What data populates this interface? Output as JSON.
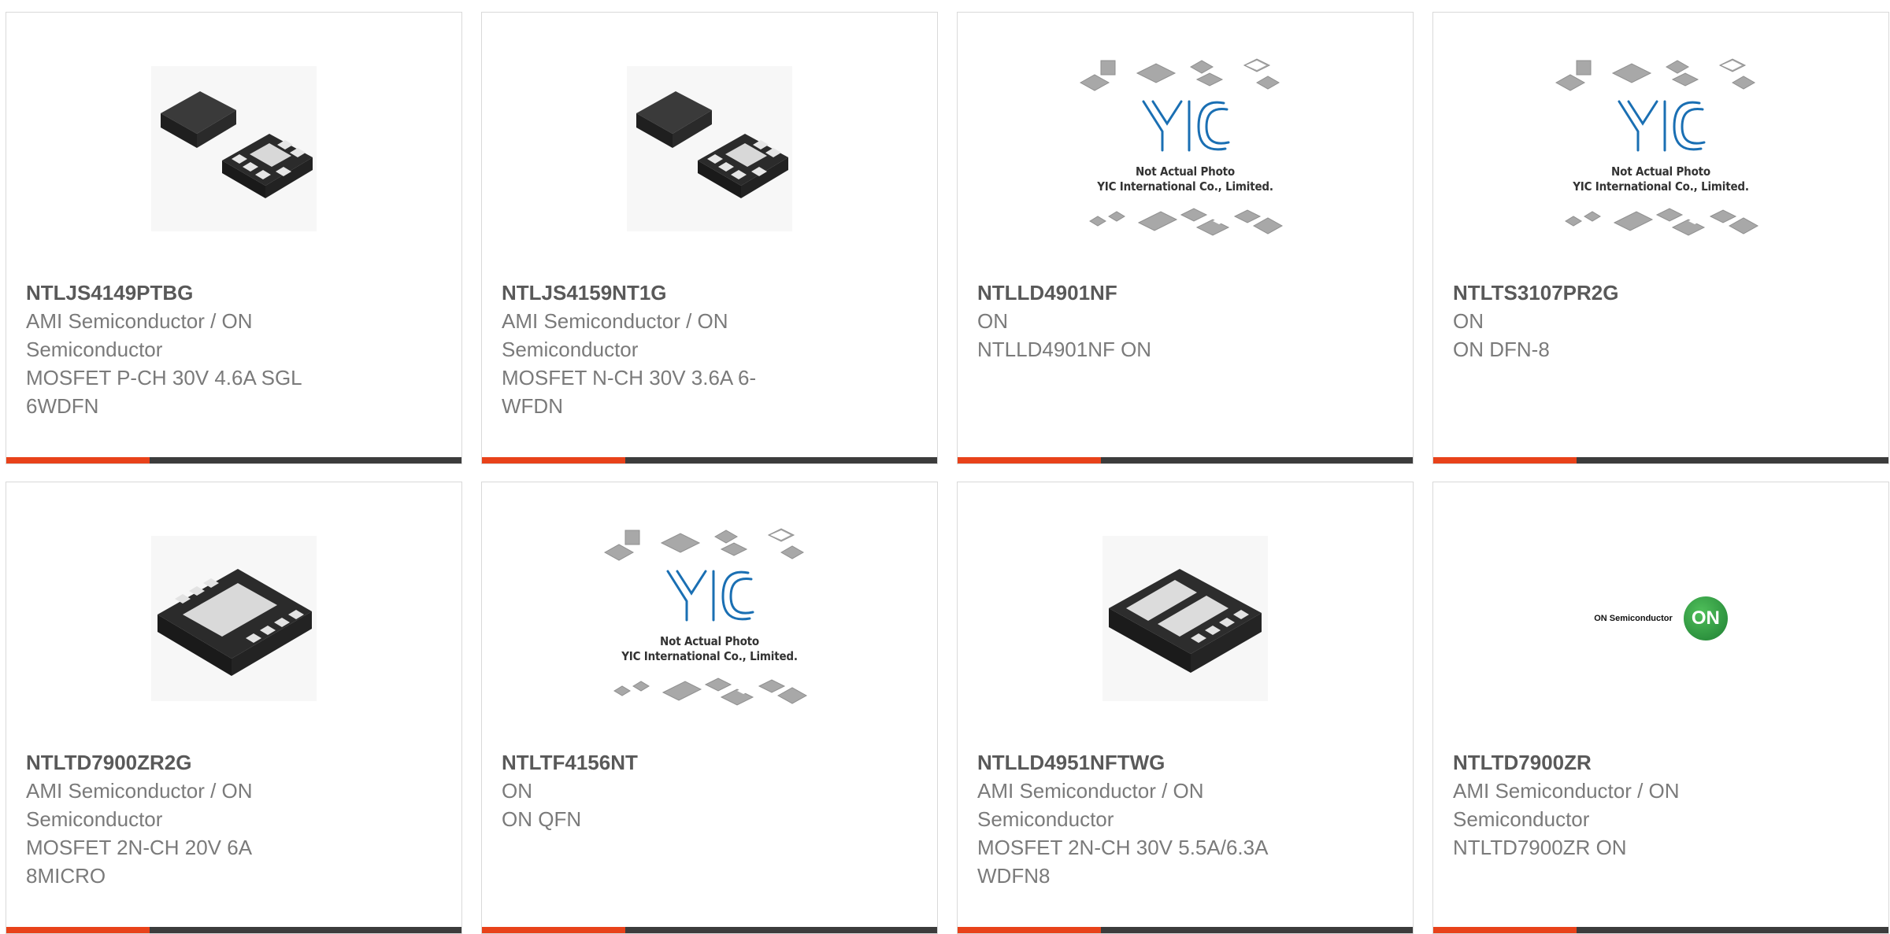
{
  "colors": {
    "accent": "#e8421a",
    "bar": "#3c3c3c",
    "border": "#d9d9d9"
  },
  "placeholder": {
    "line1": "Not Actual Photo",
    "line2": "YIC International Co., Limited."
  },
  "logo": {
    "brand_text": "ON Semiconductor",
    "badge_text": "ON"
  },
  "products": [
    {
      "part": "NTLJS4149PTBG",
      "maker": "AMI Semiconductor / ON Semiconductor",
      "desc": "MOSFET P-CH 30V 4.6A SGL 6WDFN",
      "image": "chip-pair"
    },
    {
      "part": "NTLJS4159NT1G",
      "maker": "AMI Semiconductor / ON Semiconductor",
      "desc": "MOSFET N-CH 30V 3.6A 6-WFDN",
      "image": "chip-pair"
    },
    {
      "part": "NTLLD4901NF",
      "maker": "ON",
      "desc": "NTLLD4901NF ON",
      "image": "placeholder"
    },
    {
      "part": "NTLTS3107PR2G",
      "maker": "ON",
      "desc": "ON DFN-8",
      "image": "placeholder"
    },
    {
      "part": "NTLTD7900ZR2G",
      "maker": "AMI Semiconductor / ON Semiconductor",
      "desc": "MOSFET 2N-CH 20V 6A 8MICRO",
      "image": "dfn8"
    },
    {
      "part": "NTLTF4156NT",
      "maker": "ON",
      "desc": "ON QFN",
      "image": "placeholder"
    },
    {
      "part": "NTLLD4951NFTWG",
      "maker": "AMI Semiconductor / ON Semiconductor",
      "desc": "MOSFET 2N-CH 30V 5.5A/6.3A WDFN8",
      "image": "wdfn8"
    },
    {
      "part": "NTLTD7900ZR",
      "maker": "AMI Semiconductor / ON Semiconductor",
      "desc": "NTLTD7900ZR ON",
      "image": "on-logo"
    }
  ]
}
